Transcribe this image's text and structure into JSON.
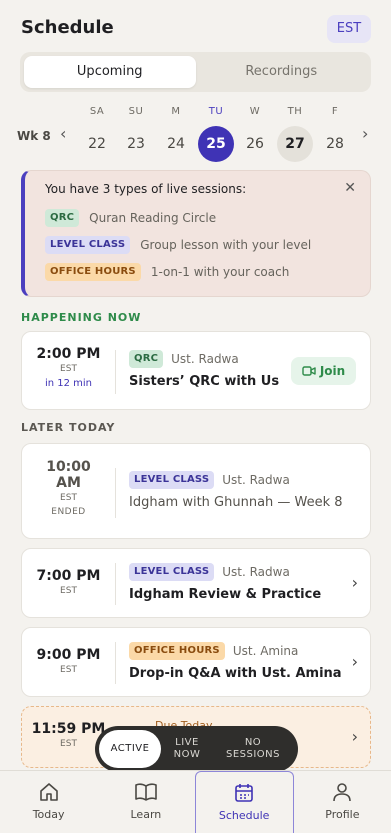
{
  "header": {
    "title": "Schedule",
    "timezone": "EST"
  },
  "segments": [
    {
      "label": "Upcoming",
      "active": true
    },
    {
      "label": "Recordings",
      "active": false
    }
  ],
  "week": {
    "label": "Wk 8",
    "days": [
      {
        "dow": "SA",
        "num": "22"
      },
      {
        "dow": "SU",
        "num": "23"
      },
      {
        "dow": "M",
        "num": "24"
      },
      {
        "dow": "TU",
        "num": "25",
        "today": true
      },
      {
        "dow": "W",
        "num": "26"
      },
      {
        "dow": "TH",
        "num": "27",
        "marked": true
      },
      {
        "dow": "F",
        "num": "28"
      }
    ]
  },
  "info": {
    "title": "You have 3 types of live sessions:",
    "items": [
      {
        "tag": "QRC",
        "desc": "Quran Reading Circle"
      },
      {
        "tag": "LEVEL CLASS",
        "desc": "Group lesson with your level"
      },
      {
        "tag": "OFFICE HOURS",
        "desc": "1-on-1 with your coach"
      }
    ]
  },
  "sections": {
    "now": "HAPPENING NOW",
    "later": "LATER TODAY"
  },
  "sessions": [
    {
      "time": "2:00 PM",
      "tz": "EST",
      "sub": "in 12 min",
      "tag": "QRC",
      "coach": "Ust. Radwa",
      "name": "Sisters’ QRC with Ust...",
      "action": "Join"
    },
    {
      "time_l1": "10:00",
      "time_l2": "AM",
      "tz": "EST",
      "sub": "ENDED",
      "tag": "LEVEL CLASS",
      "coach": "Ust. Radwa",
      "name": "Idgham with Ghunnah — Week 8"
    },
    {
      "time": "7:00 PM",
      "tz": "EST",
      "tag": "LEVEL CLASS",
      "coach": "Ust. Radwa",
      "name": "Idgham Review & Practice"
    },
    {
      "time": "9:00 PM",
      "tz": "EST",
      "tag": "OFFICE HOURS",
      "coach": "Ust. Amina",
      "name": "Drop-in Q&A with Ust. Amina"
    },
    {
      "time": "11:59 PM",
      "tz": "EST",
      "due": "Due Today"
    }
  ],
  "toggle": [
    {
      "label": "ACTIVE",
      "active": true
    },
    {
      "label_l1": "LIVE",
      "label_l2": "NOW"
    },
    {
      "label_l1": "NO",
      "label_l2": "SESSIONS"
    }
  ],
  "tabs": [
    {
      "label": "Today",
      "icon": "home-icon"
    },
    {
      "label": "Learn",
      "icon": "book-icon"
    },
    {
      "label": "Schedule",
      "icon": "calendar-icon",
      "active": true
    },
    {
      "label": "Profile",
      "icon": "person-icon"
    }
  ],
  "colors": {
    "accent": "#3f33b5",
    "live": "#2e8b4a",
    "background": "#f4f2ee"
  }
}
